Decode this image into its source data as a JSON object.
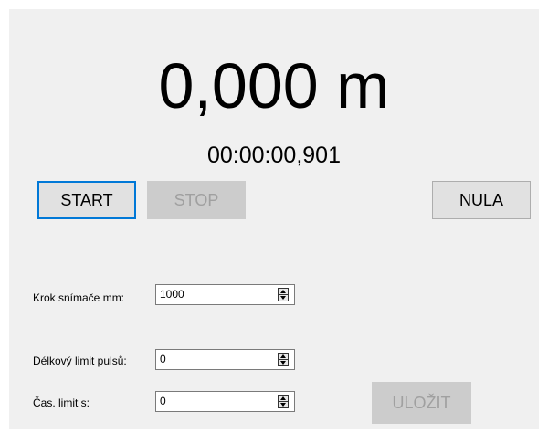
{
  "display": {
    "distance": "0,000 m",
    "elapsed": "00:00:00,901"
  },
  "buttons": {
    "start": "START",
    "stop": "STOP",
    "nula": "NULA",
    "ulozit": "ULOŽIT"
  },
  "fields": {
    "krok": {
      "label": "Krok snímače mm:",
      "value": "1000"
    },
    "delkovy": {
      "label": "Délkový limit pulsů:",
      "value": "0"
    },
    "cas": {
      "label": "Čas. limit s:",
      "value": "0"
    }
  },
  "icons": {
    "spinner": "up-down-arrows-icon"
  }
}
